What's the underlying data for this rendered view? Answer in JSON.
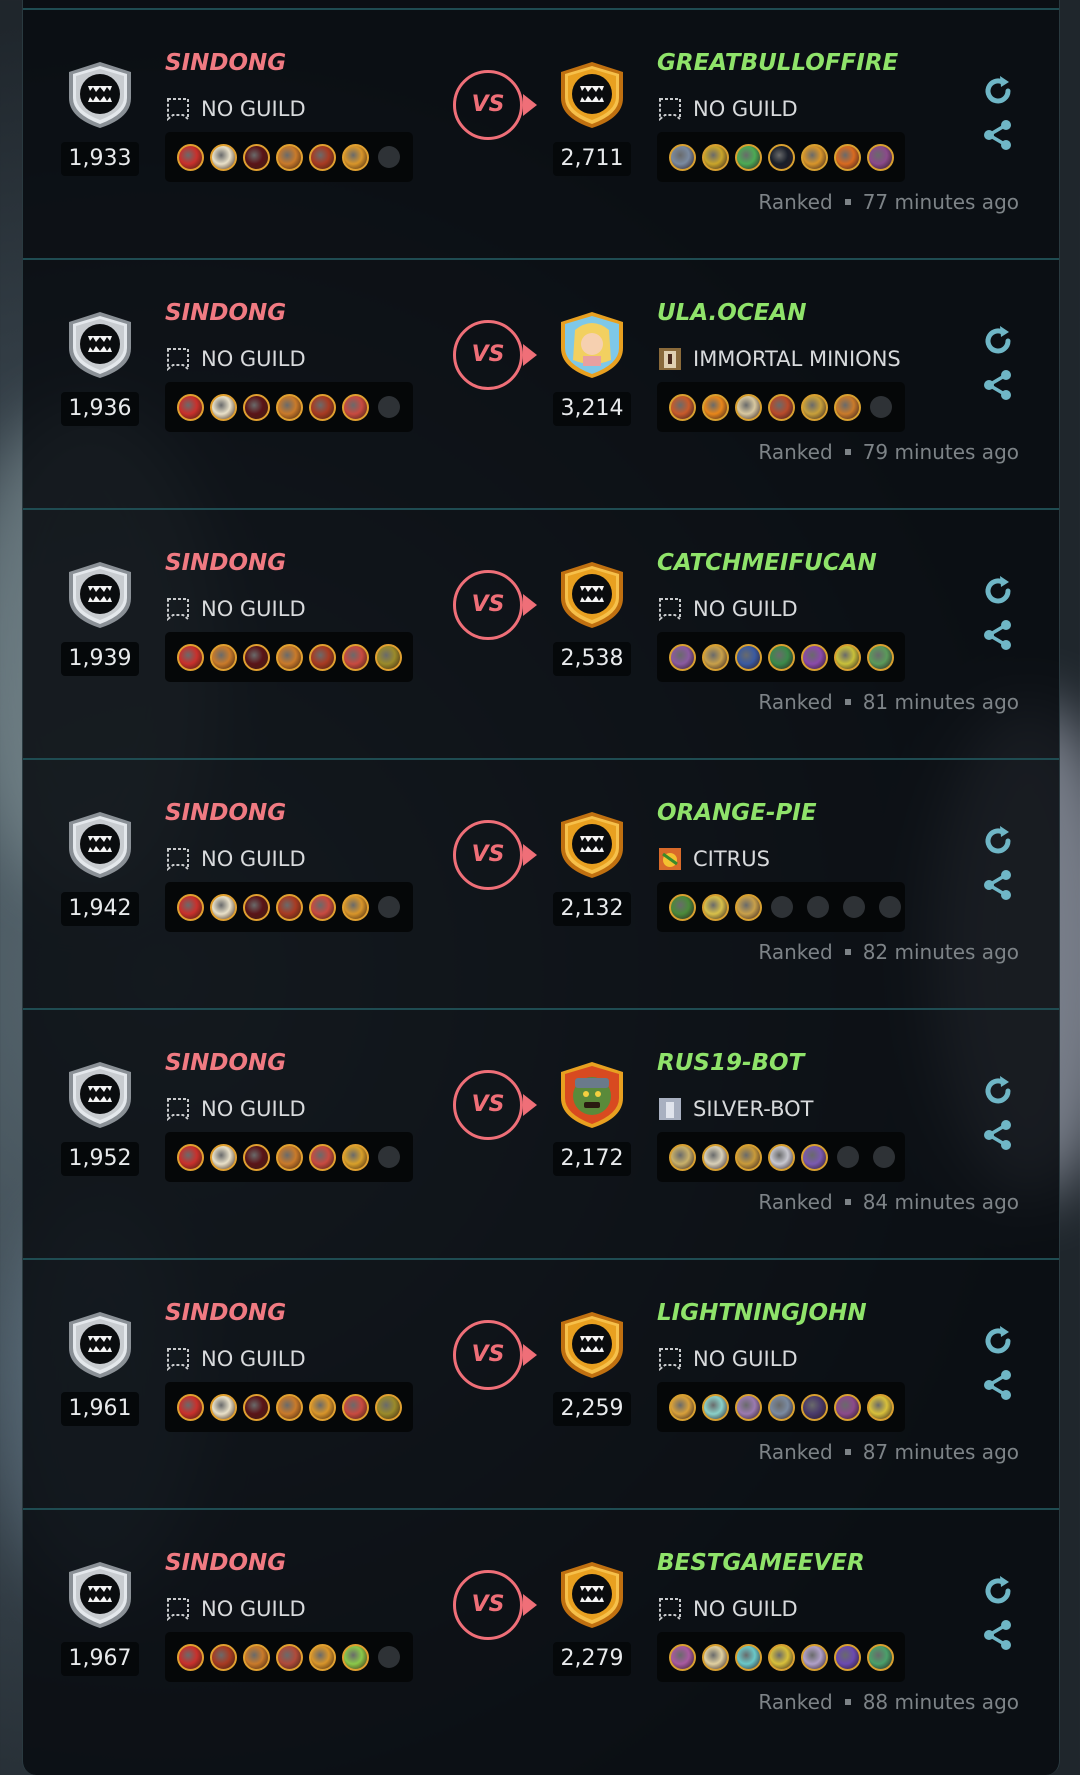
{
  "colors": {
    "left_name": "#f07a82",
    "right_name": "#8fe36a",
    "vs": "#ef6f78",
    "divider": "#1f4c52"
  },
  "icons": {
    "rematch": "refresh-icon",
    "share": "share-icon",
    "no_guild": "dashed-banner-icon"
  },
  "matches": [
    {
      "player": {
        "name": "SINDONG",
        "guild": "NO GUILD",
        "rating": "1,933",
        "badge": "silver"
      },
      "opponent": {
        "name": "GREATBULLOFFIRE",
        "guild": "NO GUILD",
        "rating": "2,711",
        "badge": "gold"
      },
      "vs": "VS",
      "type": "Ranked",
      "time": "77 minutes ago",
      "player_team": [
        "#c9302c",
        "#e8e0c8",
        "#5a1418",
        "#c97a2a",
        "#a83a22",
        "#d8952a",
        "empty"
      ],
      "opponent_team": [
        "#7a8aa0",
        "#c9a52a",
        "#4caa54",
        "#1a1f2a",
        "#d8952a",
        "#d86a20",
        "#8a4a8a"
      ]
    },
    {
      "player": {
        "name": "SINDONG",
        "guild": "NO GUILD",
        "rating": "1,936",
        "badge": "silver"
      },
      "opponent": {
        "name": "ULA.OCEAN",
        "guild": "IMMORTAL MINIONS",
        "rating": "3,214",
        "badge": "avatar"
      },
      "vs": "VS",
      "type": "Ranked",
      "time": "79 minutes ago",
      "player_team": [
        "#c9302c",
        "#e8e0c8",
        "#5a1418",
        "#c97a2a",
        "#a83a22",
        "#c84a40",
        "empty"
      ],
      "opponent_team": [
        "#c85a2a",
        "#e8861a",
        "#d8c8a0",
        "#b84a2a",
        "#c8a03a",
        "#c97a2a",
        "empty"
      ]
    },
    {
      "player": {
        "name": "SINDONG",
        "guild": "NO GUILD",
        "rating": "1,939",
        "badge": "silver"
      },
      "opponent": {
        "name": "CATCHMEIFUCAN",
        "guild": "NO GUILD",
        "rating": "2,538",
        "badge": "gold"
      },
      "vs": "VS",
      "type": "Ranked",
      "time": "81 minutes ago",
      "player_team": [
        "#c9302c",
        "#c97a2a",
        "#5a1418",
        "#c97a2a",
        "#a83a22",
        "#c84a40",
        "#9a8a2a"
      ],
      "opponent_team": [
        "#8a5aa0",
        "#c8a04a",
        "#3a5aa0",
        "#3a8a4a",
        "#8a4aaa",
        "#c8c03a",
        "#5a9a5a"
      ]
    },
    {
      "player": {
        "name": "SINDONG",
        "guild": "NO GUILD",
        "rating": "1,942",
        "badge": "silver"
      },
      "opponent": {
        "name": "ORANGE-PIE",
        "guild": "CITRUS",
        "rating": "2,132",
        "badge": "gold"
      },
      "vs": "VS",
      "type": "Ranked",
      "time": "82 minutes ago",
      "player_team": [
        "#c9302c",
        "#e8e0c8",
        "#5a1418",
        "#a83a22",
        "#c84a40",
        "#d8952a",
        "empty"
      ],
      "opponent_team": [
        "#4a8a3a",
        "#d8c04a",
        "#c8a04a",
        "empty",
        "empty",
        "empty",
        "empty"
      ]
    },
    {
      "player": {
        "name": "SINDONG",
        "guild": "NO GUILD",
        "rating": "1,952",
        "badge": "silver"
      },
      "opponent": {
        "name": "RUS19-BOT",
        "guild": "SILVER-BOT",
        "rating": "2,172",
        "badge": "avatar-orc"
      },
      "vs": "VS",
      "type": "Ranked",
      "time": "84 minutes ago",
      "player_team": [
        "#c9302c",
        "#e8e0c8",
        "#5a1418",
        "#c97a2a",
        "#c84a40",
        "#d8a02a",
        "empty"
      ],
      "opponent_team": [
        "#c8b06a",
        "#d8d0b8",
        "#c89a3a",
        "#c8c8d0",
        "#7a5ab0",
        "empty",
        "empty"
      ]
    },
    {
      "player": {
        "name": "SINDONG",
        "guild": "NO GUILD",
        "rating": "1,961",
        "badge": "silver"
      },
      "opponent": {
        "name": "LIGHTNINGJOHN",
        "guild": "NO GUILD",
        "rating": "2,259",
        "badge": "gold"
      },
      "vs": "VS",
      "type": "Ranked",
      "time": "87 minutes ago",
      "player_team": [
        "#c9302c",
        "#e8e0c8",
        "#5a1418",
        "#c97a2a",
        "#d8952a",
        "#c84a40",
        "#9a8a2a"
      ],
      "opponent_team": [
        "#d8a03a",
        "#8ad0c8",
        "#9a7ab0",
        "#7a8aa0",
        "#4a3a6a",
        "#8a4a8a",
        "#d8c03a"
      ]
    },
    {
      "player": {
        "name": "SINDONG",
        "guild": "NO GUILD",
        "rating": "1,967",
        "badge": "silver"
      },
      "opponent": {
        "name": "BESTGAMEEVER",
        "guild": "NO GUILD",
        "rating": "2,279",
        "badge": "gold"
      },
      "vs": "VS",
      "type": "Ranked",
      "time": "88 minutes ago",
      "player_team": [
        "#c9302c",
        "#a83a22",
        "#c97a2a",
        "#b04a3a",
        "#d8952a",
        "#8ac84a",
        "empty"
      ],
      "opponent_team": [
        "#a85aa0",
        "#e0d0a0",
        "#6ac8c8",
        "#d8c03a",
        "#b0a0c8",
        "#6a4ab0",
        "#4aa06a"
      ]
    }
  ]
}
